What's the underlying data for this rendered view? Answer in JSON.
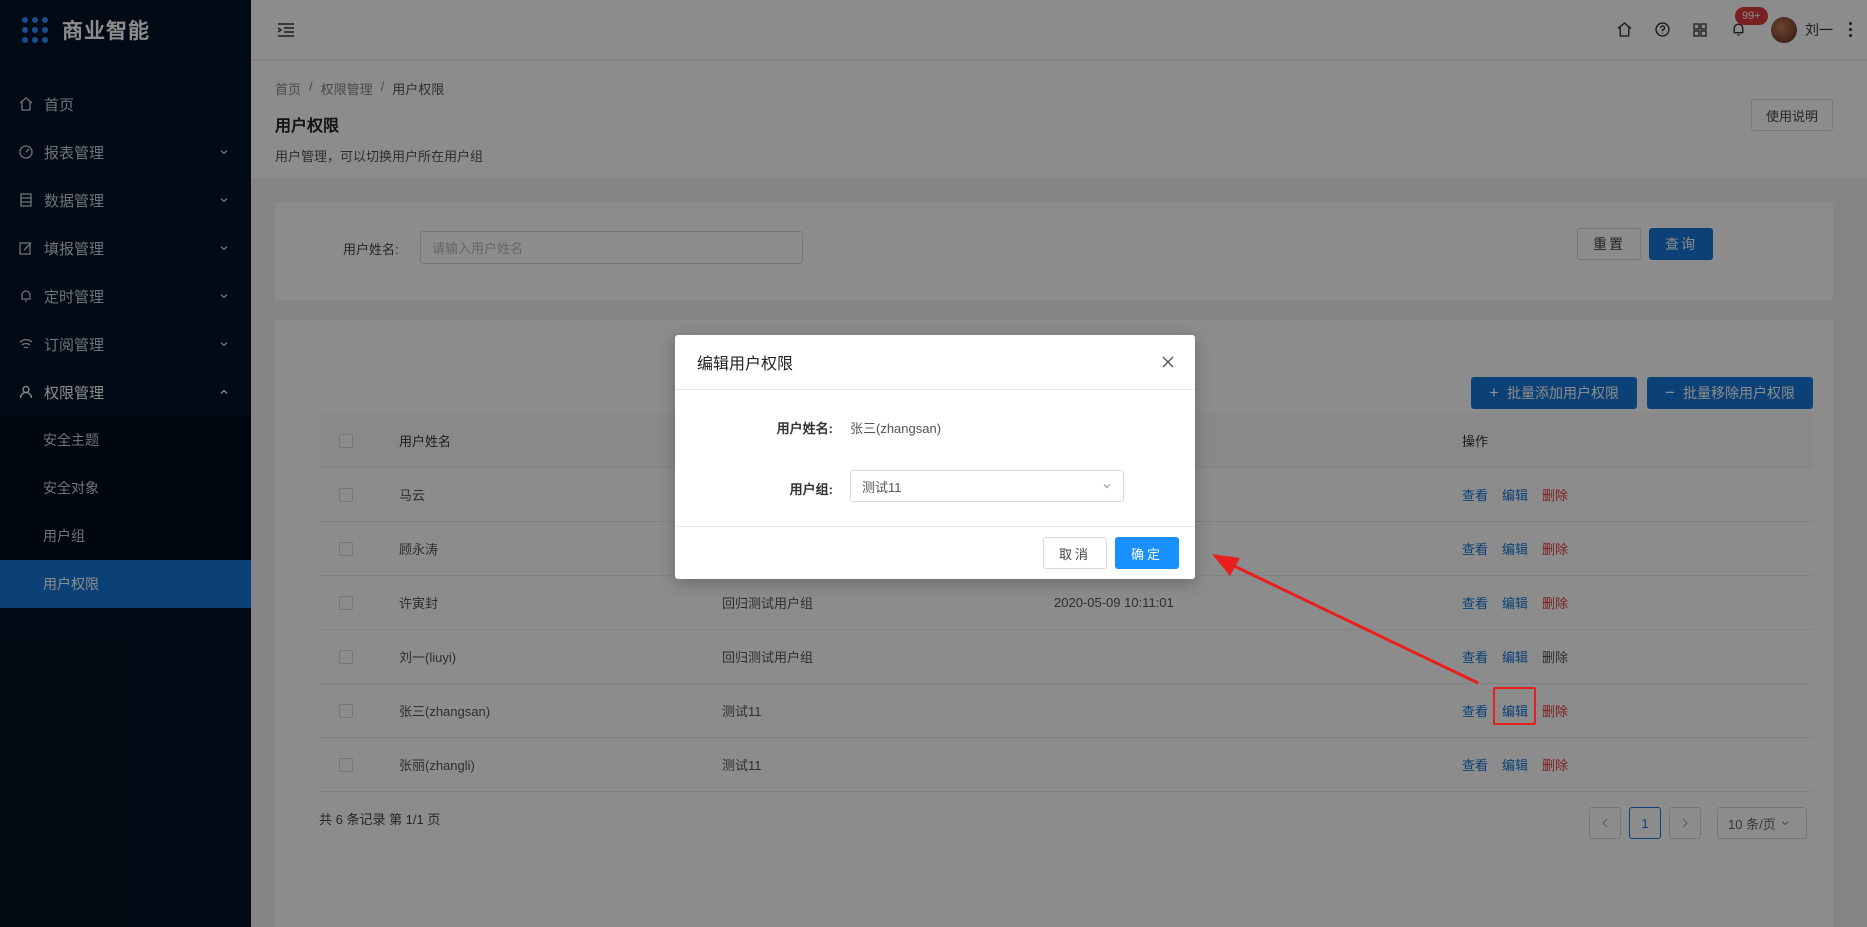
{
  "app": {
    "title": "商业智能"
  },
  "sidebar": {
    "items": [
      {
        "label": "首页",
        "icon": "home-icon"
      },
      {
        "label": "报表管理",
        "icon": "dashboard-icon"
      },
      {
        "label": "数据管理",
        "icon": "database-icon"
      },
      {
        "label": "填报管理",
        "icon": "edit-icon"
      },
      {
        "label": "定时管理",
        "icon": "bell-icon"
      },
      {
        "label": "订阅管理",
        "icon": "wifi-icon"
      },
      {
        "label": "权限管理",
        "icon": "user-icon"
      }
    ],
    "subitems": [
      {
        "label": "安全主题"
      },
      {
        "label": "安全对象"
      },
      {
        "label": "用户组"
      },
      {
        "label": "用户权限",
        "active": true
      }
    ]
  },
  "header": {
    "notify_badge": "99+",
    "username": "刘一"
  },
  "page": {
    "breadcrumb": [
      "首页",
      "权限管理",
      "用户权限"
    ],
    "separator": "/",
    "title": "用户权限",
    "description": "用户管理，可以切换用户所在用户组",
    "help_button": "使用说明"
  },
  "search": {
    "label": "用户姓名:",
    "placeholder": "请输入用户姓名",
    "reset_button": "重置",
    "query_button": "查询"
  },
  "actions": {
    "batch_add": "批量添加用户权限",
    "batch_remove": "批量移除用户权限"
  },
  "table": {
    "columns": {
      "name": "用户姓名",
      "ops": "操作"
    },
    "op_view": "查看",
    "op_edit": "编辑",
    "op_delete": "删除",
    "rows": [
      {
        "name": "马云",
        "group": "",
        "time": ""
      },
      {
        "name": "顾永涛",
        "group": "",
        "time": ""
      },
      {
        "name": "许寅封",
        "group": "回归测试用户组",
        "time": "2020-05-09 10:11:01"
      },
      {
        "name": "刘一(liuyi)",
        "group": "回归测试用户组",
        "time": ""
      },
      {
        "name": "张三(zhangsan)",
        "group": "测试11",
        "time": ""
      },
      {
        "name": "张丽(zhangli)",
        "group": "测试11",
        "time": ""
      }
    ]
  },
  "pagination": {
    "summary": "共 6 条记录 第 1/1 页",
    "current_page": "1",
    "page_size": "10 条/页"
  },
  "modal": {
    "title": "编辑用户权限",
    "user_label": "用户姓名:",
    "user_value": "张三(zhangsan)",
    "group_label": "用户组:",
    "group_value": "测试11",
    "cancel_button": "取消",
    "ok_button": "确定"
  },
  "colors": {
    "primary": "#1677d9",
    "sidebar_bg": "#041527",
    "danger": "#e03b3b",
    "annotation": "#e8201d"
  }
}
